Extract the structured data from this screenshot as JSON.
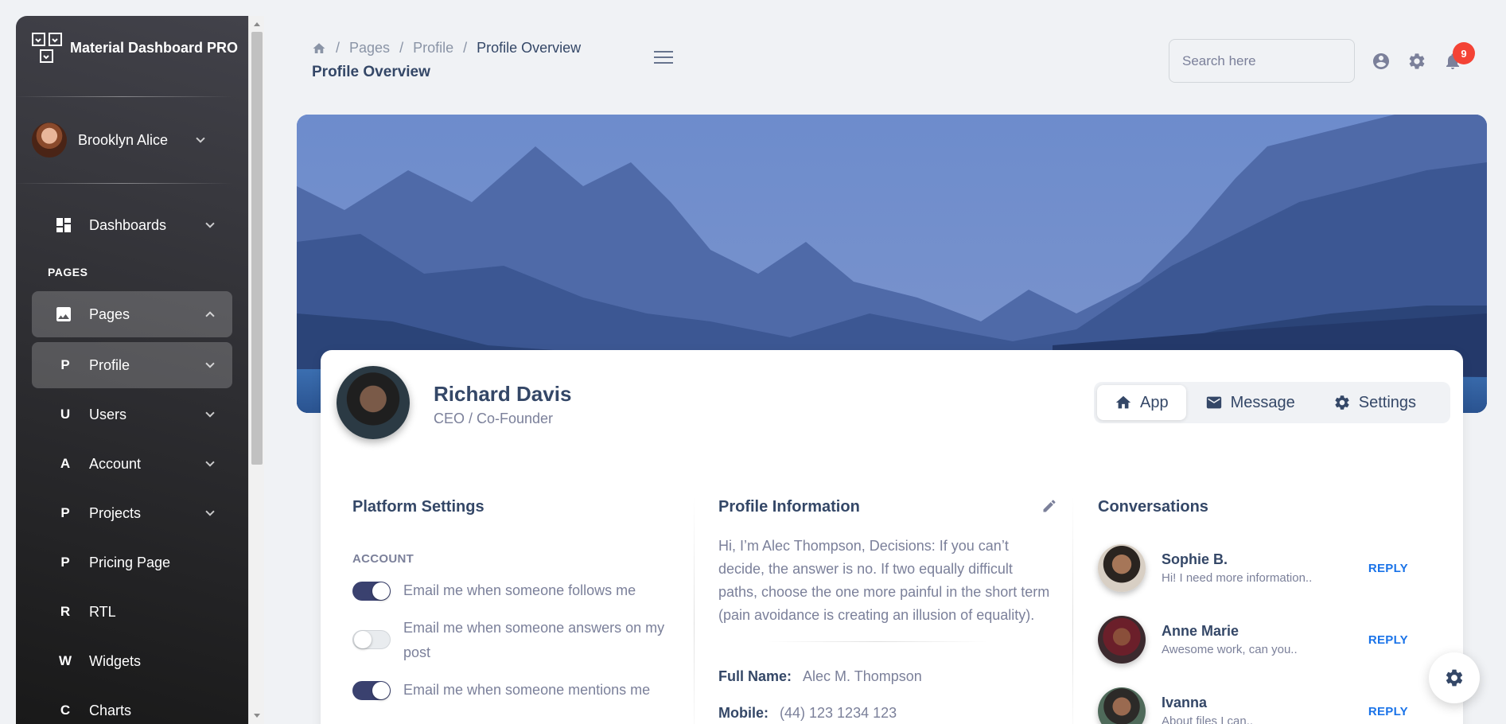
{
  "sidebar": {
    "brand": "Material Dashboard PRO",
    "user": "Brooklyn Alice",
    "dashboards": "Dashboards",
    "section_label": "PAGES",
    "items": [
      {
        "letter": "",
        "label": "Pages"
      },
      {
        "letter": "P",
        "label": "Profile"
      },
      {
        "letter": "U",
        "label": "Users"
      },
      {
        "letter": "A",
        "label": "Account"
      },
      {
        "letter": "P",
        "label": "Projects"
      },
      {
        "letter": "P",
        "label": "Pricing Page"
      },
      {
        "letter": "R",
        "label": "RTL"
      },
      {
        "letter": "W",
        "label": "Widgets"
      },
      {
        "letter": "C",
        "label": "Charts"
      }
    ]
  },
  "navbar": {
    "breadcrumb": [
      "Pages",
      "Profile",
      "Profile Overview"
    ],
    "title": "Profile Overview",
    "search_placeholder": "Search here",
    "notification_count": "9"
  },
  "profile": {
    "name": "Richard Davis",
    "role": "CEO / Co-Founder",
    "tabs": [
      "App",
      "Message",
      "Settings"
    ]
  },
  "platform_settings": {
    "title": "Platform Settings",
    "section": "ACCOUNT",
    "options": [
      {
        "label": "Email me when someone follows me",
        "enabled": true
      },
      {
        "label": "Email me when someone answers on my post",
        "enabled": false
      },
      {
        "label": "Email me when someone mentions me",
        "enabled": true
      }
    ]
  },
  "profile_info": {
    "title": "Profile Information",
    "bio": "Hi, I’m Alec Thompson, Decisions: If you can’t decide, the answer is no. If two equally difficult paths, choose the one more painful in the short term (pain avoidance is creating an illusion of equality).",
    "full_name_label": "Full Name:",
    "full_name": "Alec M. Thompson",
    "mobile_label": "Mobile:",
    "mobile": "(44) 123 1234 123"
  },
  "conversations": {
    "title": "Conversations",
    "reply_label": "REPLY",
    "items": [
      {
        "name": "Sophie B.",
        "message": "Hi! I need more information.."
      },
      {
        "name": "Anne Marie",
        "message": "Awesome work, can you.."
      },
      {
        "name": "Ivanna",
        "message": "About files I can.."
      }
    ]
  },
  "colors": {
    "sidebar_dark": "#191919",
    "primary_text": "#344767",
    "muted_text": "#7b809a",
    "accent_blue": "#1a73e8",
    "badge_red": "#f44335"
  }
}
